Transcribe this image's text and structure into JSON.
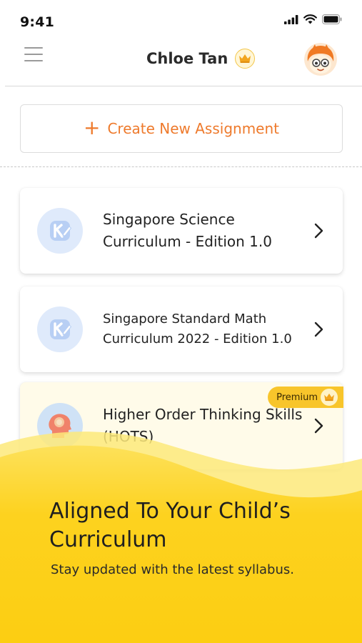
{
  "status_bar": {
    "time": "9:41",
    "icons": [
      "signal-icon",
      "wifi-icon",
      "battery-icon"
    ]
  },
  "header": {
    "menu_icon": "hamburger-menu-icon",
    "user_name": "Chloe Tan",
    "crown_icon": "crown-icon",
    "avatar_icon": "avatar-icon"
  },
  "actions": {
    "create_plus": "+",
    "create_label": "Create New Assignment"
  },
  "curricula": [
    {
      "title": "Singapore Science Curriculum - Edition 1.0",
      "icon": "koobits-logo-icon",
      "premium": false
    },
    {
      "title": "Singapore Standard Math Curriculum 2022 - Edition 1.0",
      "icon": "koobits-logo-icon",
      "premium": false
    },
    {
      "title": "Higher Order Thinking Skills (HOTS)",
      "icon": "brain-head-icon",
      "premium": true,
      "badge_label": "Premium"
    }
  ],
  "promo": {
    "title": "Aligned To Your Child’s Curriculum",
    "subtitle": "Stay updated with the latest syllabus."
  },
  "colors": {
    "accent": "#ee7a2c",
    "premium_yellow": "#f8c52b",
    "wave_yellow": "#fdd21f",
    "wave_light": "#fde97a",
    "logo_bg": "#dfeafb"
  }
}
